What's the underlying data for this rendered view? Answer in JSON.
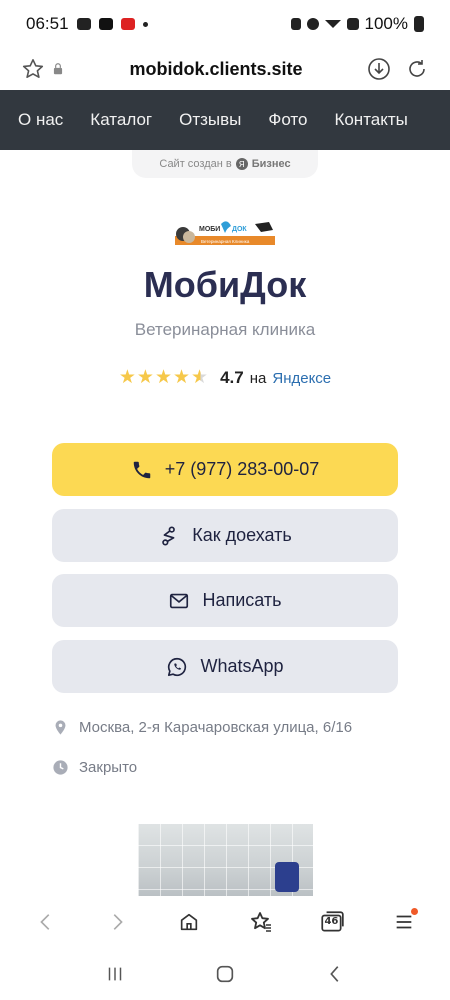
{
  "status": {
    "time": "06:51",
    "battery": "100%"
  },
  "browser": {
    "url": "mobidok.clients.site",
    "tab_count": "46"
  },
  "nav": {
    "items": [
      "О нас",
      "Каталог",
      "Отзывы",
      "Фото",
      "Контакты"
    ]
  },
  "badge": {
    "prefix": "Сайт создан в",
    "ya": "Я",
    "brand": "Бизнес"
  },
  "logo": {
    "top_text": "МОБИ",
    "top_text2": "ДОК",
    "bottom_text": "Ветеринарная Клиника"
  },
  "clinic": {
    "name": "МобиДок",
    "subtitle": "Ветеринарная клиника",
    "rating": "4.7",
    "rating_on": "на",
    "rating_source": "Яндексе",
    "rating_stars": 4.7
  },
  "buttons": {
    "phone": "+7 (977) 283-00-07",
    "route": "Как доехать",
    "write": "Написать",
    "whatsapp": "WhatsApp"
  },
  "info": {
    "address": "Москва, 2-я Карачаровская улица, 6/16",
    "hours": "Закрыто"
  },
  "colors": {
    "primary_button": "#fcd953",
    "nav_bg": "#32383f",
    "title": "#2b2e52",
    "link": "#2c6fb0"
  },
  "icons": [
    "star-icon",
    "lock-icon",
    "download-icon",
    "refresh-icon",
    "phone-icon",
    "route-icon",
    "mail-icon",
    "whatsapp-icon",
    "location-icon",
    "clock-icon",
    "back-icon",
    "forward-icon",
    "home-icon",
    "bookmarks-icon",
    "tabs-icon",
    "menu-icon"
  ]
}
